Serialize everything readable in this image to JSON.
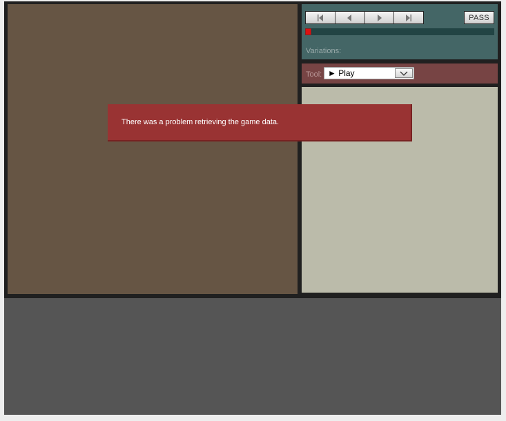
{
  "controls": {
    "pass_label": "PASS",
    "variations_label": "Variations:",
    "nav_icons": [
      "first-move-icon",
      "previous-move-icon",
      "next-move-icon",
      "last-move-icon"
    ],
    "progress": 0
  },
  "tool": {
    "label": "Tool:",
    "selected": "► Play"
  },
  "error": {
    "message": "There was a problem retrieving the game data."
  },
  "colors": {
    "board": "#665544",
    "control_panel": "#446666",
    "tool_panel": "#774444",
    "comment_panel": "#bbbbaa",
    "error": "#993333",
    "progress_marker": "#dd1111"
  }
}
